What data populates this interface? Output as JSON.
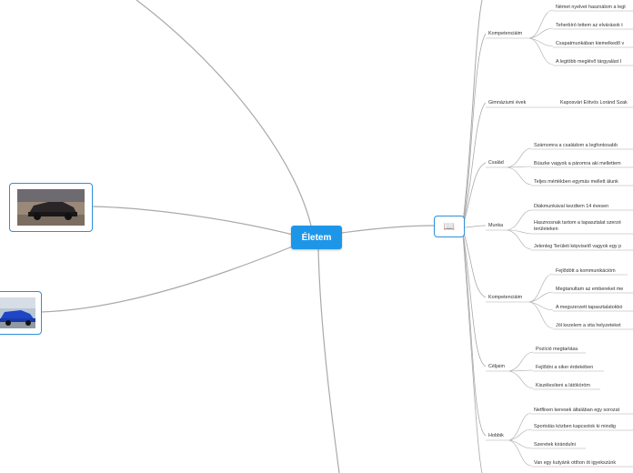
{
  "root": {
    "label": "Életem"
  },
  "book_node": {
    "icon": "book-icon",
    "glyph": "📖"
  },
  "image_nodes": [
    {
      "name": "car-image-dark-suv",
      "desc": "dark SUV photo"
    },
    {
      "name": "car-image-blue-suv",
      "desc": "blue SUV photo"
    }
  ],
  "categories": [
    {
      "key": "kompetenciaim1",
      "label": "Kompetenciáim",
      "items": [
        "Német nyelvet használom a legt",
        "Teherbíró lettem az elvárások t",
        "Csapatmunkában kiemelkedő v",
        "A legtöbb meglévő tárgyalást I"
      ]
    },
    {
      "key": "gimnazium",
      "label": "Gimnáziumi évek",
      "items": [
        "Kaposvári Eötvös Loránd Szak"
      ]
    },
    {
      "key": "csalad",
      "label": "Család",
      "items": [
        "Számomra a családom a legfontosabb",
        "Büszke vagyok a páromra aki mellettem",
        "Teljes mértékben egymás mellett álunk"
      ]
    },
    {
      "key": "munka",
      "label": "Munka",
      "items": [
        "Diákmunkával kezdtem 14 évesen",
        "Hasznosnak tartom a tapasztalat szerzé",
        "területeken",
        "Jelenleg Területi képviselő vagyok egy p"
      ]
    },
    {
      "key": "kompetenciaim2",
      "label": "Kompetenciáim",
      "items": [
        "Fejlődött a kommunikációm",
        "Megtanultam az embereket me",
        "A megszerzett tapasztalatokbó",
        "Jól kezelem a vita helyzeteket"
      ]
    },
    {
      "key": "celjaim",
      "label": "Céljaim",
      "items": [
        "Pozíció megtartása",
        "Fejlődni a siker érdekében",
        "Kiszélesíteni a látóköröm"
      ]
    },
    {
      "key": "hobbik",
      "label": "Hobbik",
      "items": [
        "Netflixen keresek általában egy sorozat",
        "Sportolás közben kapcsolok ki mindig",
        "Szeretek kirándulni",
        "Van egy kutyánk otthon öt igyekszünk"
      ]
    }
  ],
  "colors": {
    "accent": "#1e96e8",
    "line": "#9aa0a6"
  }
}
